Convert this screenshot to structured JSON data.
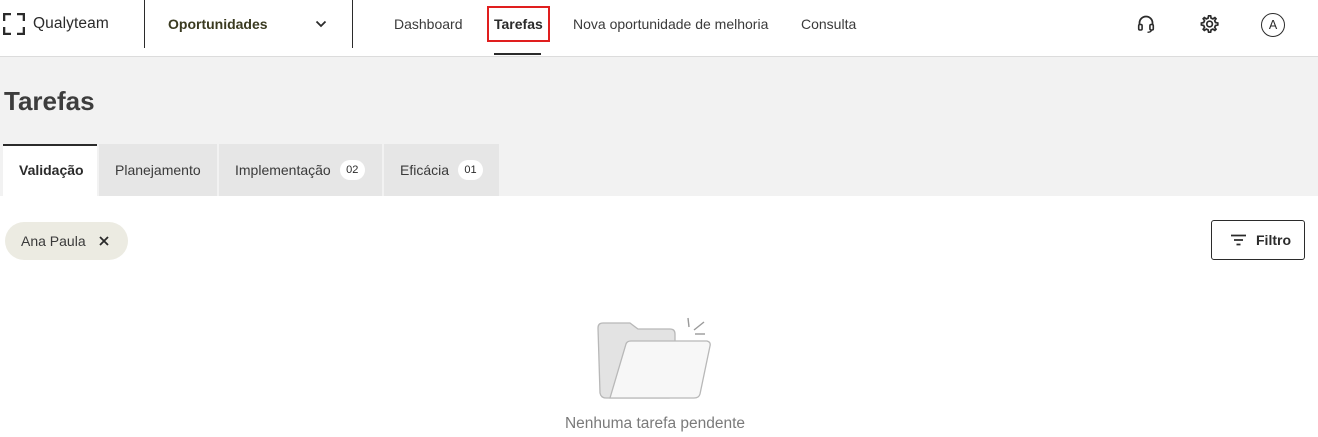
{
  "brand": {
    "name": "Qualyteam"
  },
  "module_select": {
    "label": "Oportunidades"
  },
  "nav": {
    "items": [
      {
        "label": "Dashboard"
      },
      {
        "label": "Tarefas"
      },
      {
        "label": "Nova oportunidade de melhoria"
      },
      {
        "label": "Consulta"
      }
    ]
  },
  "top_actions": {
    "support_icon": "headset-icon",
    "settings_icon": "gear-icon",
    "avatar_initial": "A"
  },
  "page": {
    "title": "Tarefas"
  },
  "tabs": [
    {
      "label": "Validação",
      "badge": null,
      "active": true
    },
    {
      "label": "Planejamento",
      "badge": null,
      "active": false
    },
    {
      "label": "Implementação",
      "badge": "02",
      "active": false
    },
    {
      "label": "Eficácia",
      "badge": "01",
      "active": false
    }
  ],
  "filters": {
    "chips": [
      {
        "label": "Ana Paula"
      }
    ],
    "button_label": "Filtro"
  },
  "empty_state": {
    "message": "Nenhuma tarefa pendente"
  },
  "colors": {
    "highlight": "#e01e1e",
    "header_bg": "#f2f2f2",
    "text": "#2b2b2b"
  }
}
